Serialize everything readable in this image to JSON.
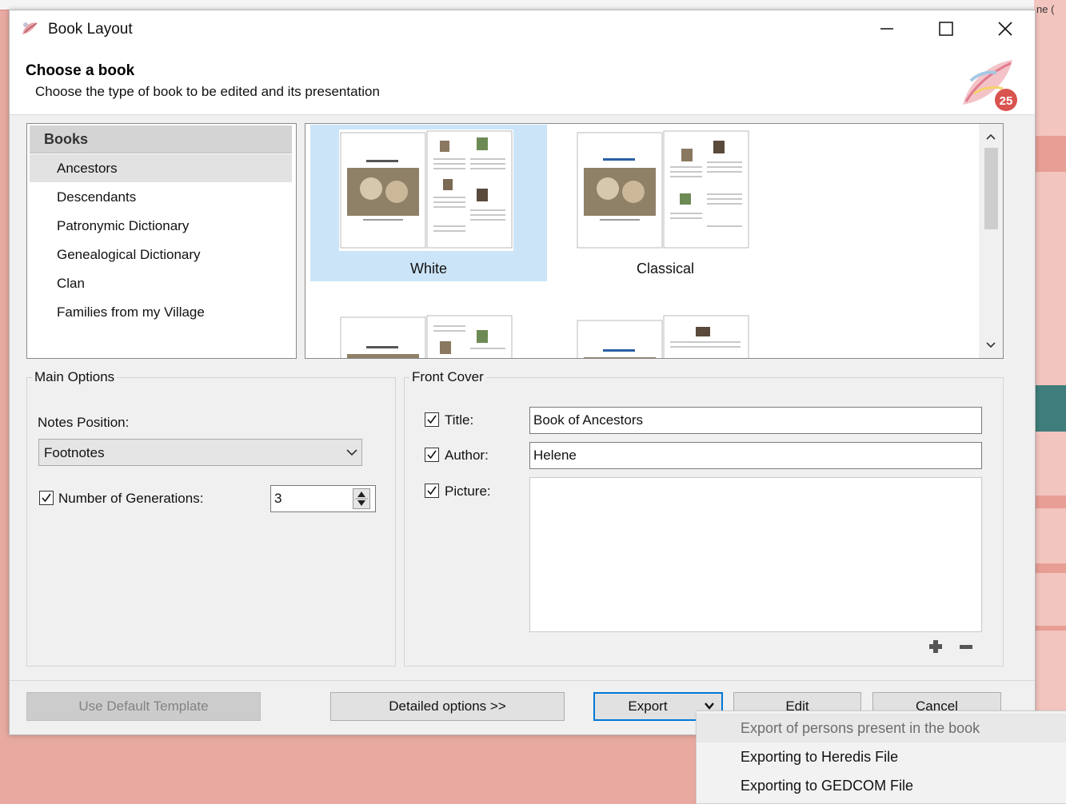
{
  "background": {
    "peek_text": "ne ("
  },
  "window": {
    "title": "Book Layout",
    "controls": [
      "minimize",
      "maximize",
      "close"
    ]
  },
  "header": {
    "title": "Choose a book",
    "subtitle": "Choose the type of book to be edited and its presentation",
    "logo_badge": "25"
  },
  "books": {
    "header": "Books",
    "items": [
      {
        "label": "Ancestors",
        "selected": true
      },
      {
        "label": "Descendants",
        "selected": false
      },
      {
        "label": "Patronymic Dictionary",
        "selected": false
      },
      {
        "label": "Genealogical Dictionary",
        "selected": false
      },
      {
        "label": "Clan",
        "selected": false
      },
      {
        "label": "Families from my Village",
        "selected": false
      }
    ]
  },
  "templates": {
    "items": [
      {
        "label": "White",
        "selected": true
      },
      {
        "label": "Classical",
        "selected": false
      },
      {
        "label": "",
        "selected": false
      },
      {
        "label": "",
        "selected": false
      }
    ]
  },
  "main_options": {
    "group_label": "Main Options",
    "notes_position_label": "Notes Position:",
    "notes_position_value": "Footnotes",
    "generations_label": "Number of Generations:",
    "generations_checked": true,
    "generations_value": "3"
  },
  "front_cover": {
    "group_label": "Front Cover",
    "title_label": "Title:",
    "title_checked": true,
    "title_value": "Book of Ancestors",
    "author_label": "Author:",
    "author_checked": true,
    "author_value": "Helene",
    "picture_label": "Picture:",
    "picture_checked": true
  },
  "buttons": {
    "use_default": "Use Default Template",
    "detailed": "Detailed options >>",
    "export": "Export",
    "edit": "Edit",
    "cancel": "Cancel"
  },
  "export_menu": {
    "items": [
      {
        "label": "Export of persons present in the book",
        "enabled": false
      },
      {
        "label": "Exporting to Heredis File",
        "enabled": true
      },
      {
        "label": "Exporting to GEDCOM File",
        "enabled": true
      }
    ]
  },
  "colors": {
    "selection": "#cce4f7",
    "accent": "#0078d7",
    "background_app": "#e8a9a0"
  }
}
